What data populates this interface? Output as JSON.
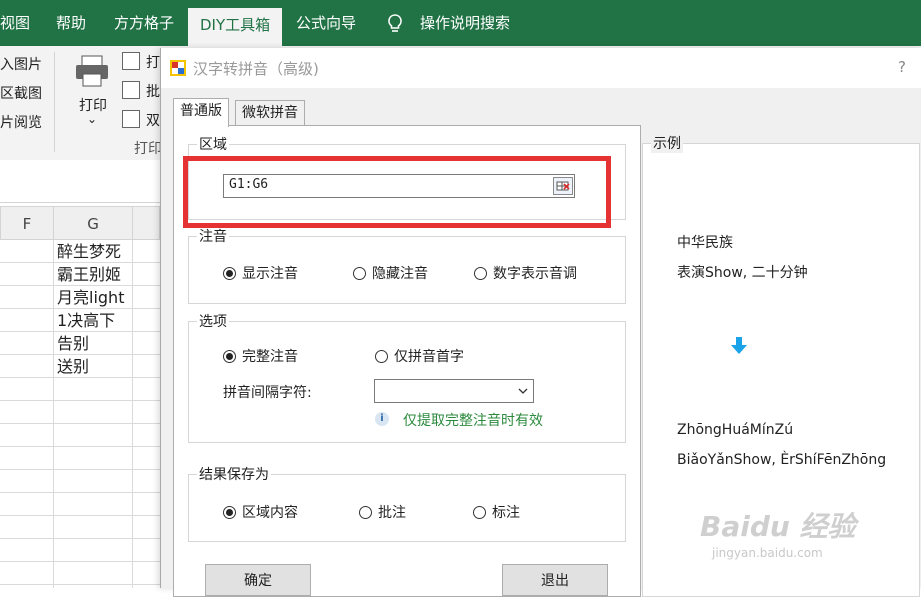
{
  "ribbon": {
    "tabs": [
      "视图",
      "帮助",
      "方方格子",
      "DIY工具箱",
      "公式向导",
      "操作说明搜索"
    ],
    "left_items": [
      "入图片",
      "区截图",
      "片阅览"
    ],
    "print_label": "打印",
    "print_chevron": "⌄",
    "small_buttons": [
      "打",
      "批",
      "双"
    ],
    "group_label": "打印"
  },
  "sheet": {
    "col_f": "F",
    "col_g": "G",
    "cells": [
      "醉生梦死",
      "霸王别姬",
      "月亮light",
      "1决高下",
      "告别",
      "送别"
    ]
  },
  "dialog": {
    "title": "汉字转拼音（高级)",
    "help": "?",
    "tabs": [
      "普通版",
      "微软拼音"
    ],
    "region": {
      "legend": "区域",
      "value": "G1:G6"
    },
    "zhuyin": {
      "legend": "注音",
      "options": [
        "显示注音",
        "隐藏注音",
        "数字表示音调"
      ],
      "selected": 0
    },
    "options": {
      "legend": "选项",
      "radios": [
        "完整注音",
        "仅拼音首字"
      ],
      "selected": 0,
      "separator_label": "拼音间隔字符:",
      "separator_value": "",
      "hint": "仅提取完整注音时有效"
    },
    "save_as": {
      "legend": "结果保存为",
      "options": [
        "区域内容",
        "批注",
        "标注"
      ],
      "selected": 0
    },
    "ok_label": "确定",
    "exit_label": "退出",
    "example": {
      "legend": "示例",
      "before": [
        "中华民族",
        "表演Show, 二十分钟"
      ],
      "after": [
        "ZhōngHuáMínZú",
        "BiǎoYǎnShow, ÈrShíFēnZhōng"
      ]
    }
  },
  "watermark": {
    "main": "Baidu 经验",
    "sub": "jingyan.baidu.com"
  },
  "colors": {
    "ribbon_green": "#217346",
    "highlight_red": "#e53333",
    "arrow_blue": "#1aa3e8"
  }
}
